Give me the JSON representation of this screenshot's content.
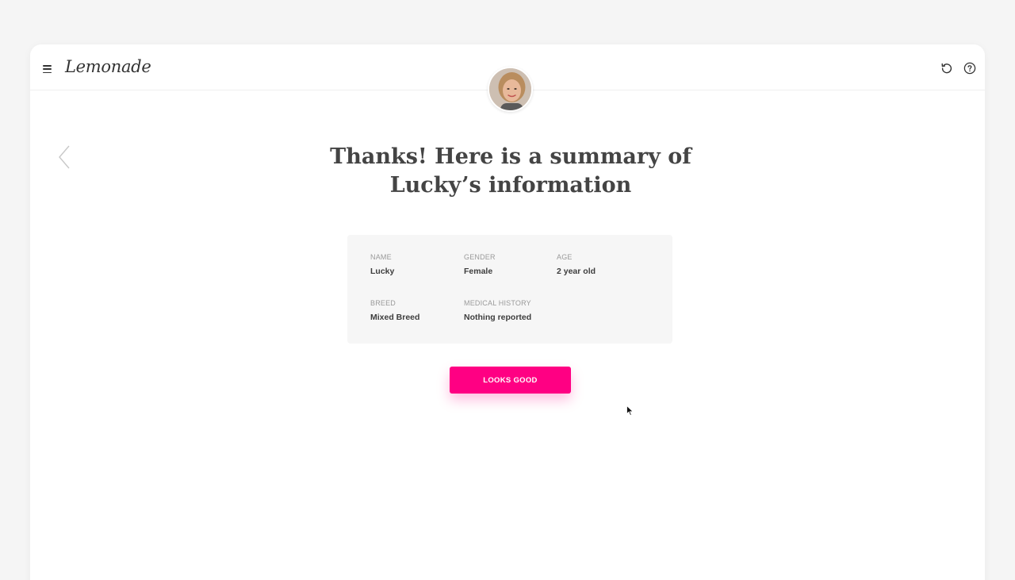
{
  "app": {
    "logo_text": "Lemonade"
  },
  "topbar": {
    "menu_icon": "hamburger-icon",
    "restart_icon": "restart-icon",
    "help_icon": "help-circle-icon"
  },
  "assistant": {
    "avatar_icon": "assistant-avatar"
  },
  "headline": {
    "line1": "Thanks! Here is a summary of",
    "line2": "Lucky’s information"
  },
  "summary": {
    "fields": [
      {
        "label": "NAME",
        "value": "Lucky"
      },
      {
        "label": "GENDER",
        "value": "Female"
      },
      {
        "label": "AGE",
        "value": "2 year old"
      },
      {
        "label": "BREED",
        "value": "Mixed Breed"
      },
      {
        "label": "MEDICAL HISTORY",
        "value": "Nothing reported"
      }
    ]
  },
  "actions": {
    "confirm_label": "LOOKS GOOD"
  },
  "colors": {
    "accent": "#ff0083",
    "background": "#f5f5f5",
    "card": "#ffffff",
    "summary_bg": "#f6f6f6"
  }
}
